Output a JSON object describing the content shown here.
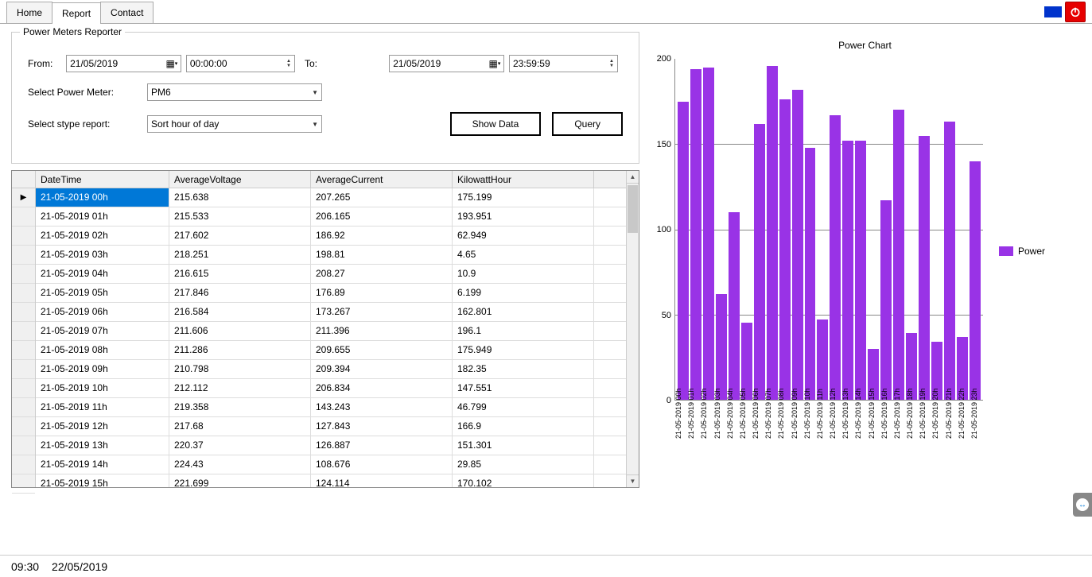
{
  "tabs": {
    "home": "Home",
    "report": "Report",
    "contact": "Contact",
    "active": "report"
  },
  "reporter": {
    "title": "Power Meters Reporter",
    "from_label": "From:",
    "from_date": "21/05/2019",
    "from_time": "00:00:00",
    "to_label": "To:",
    "to_date": "21/05/2019",
    "to_time": "23:59:59",
    "meter_label": "Select Power Meter:",
    "meter_value": "PM6",
    "stype_label": "Select stype report:",
    "stype_value": "Sort hour of day",
    "show_data": "Show Data",
    "query": "Query"
  },
  "grid": {
    "cols": {
      "dt": "DateTime",
      "av": "AverageVoltage",
      "ac": "AverageCurrent",
      "kh": "KilowattHour"
    },
    "rows": [
      {
        "dt": "21-05-2019 00h",
        "av": "215.638",
        "ac": "207.265",
        "kh": "175.199"
      },
      {
        "dt": "21-05-2019 01h",
        "av": "215.533",
        "ac": "206.165",
        "kh": "193.951"
      },
      {
        "dt": "21-05-2019 02h",
        "av": "217.602",
        "ac": "186.92",
        "kh": "62.949"
      },
      {
        "dt": "21-05-2019 03h",
        "av": "218.251",
        "ac": "198.81",
        "kh": "4.65"
      },
      {
        "dt": "21-05-2019 04h",
        "av": "216.615",
        "ac": "208.27",
        "kh": "10.9"
      },
      {
        "dt": "21-05-2019 05h",
        "av": "217.846",
        "ac": "176.89",
        "kh": "6.199"
      },
      {
        "dt": "21-05-2019 06h",
        "av": "216.584",
        "ac": "173.267",
        "kh": "162.801"
      },
      {
        "dt": "21-05-2019 07h",
        "av": "211.606",
        "ac": "211.396",
        "kh": "196.1"
      },
      {
        "dt": "21-05-2019 08h",
        "av": "211.286",
        "ac": "209.655",
        "kh": "175.949"
      },
      {
        "dt": "21-05-2019 09h",
        "av": "210.798",
        "ac": "209.394",
        "kh": "182.35"
      },
      {
        "dt": "21-05-2019 10h",
        "av": "212.112",
        "ac": "206.834",
        "kh": "147.551"
      },
      {
        "dt": "21-05-2019 11h",
        "av": "219.358",
        "ac": "143.243",
        "kh": "46.799"
      },
      {
        "dt": "21-05-2019 12h",
        "av": "217.68",
        "ac": "127.843",
        "kh": "166.9"
      },
      {
        "dt": "21-05-2019 13h",
        "av": "220.37",
        "ac": "126.887",
        "kh": "151.301"
      },
      {
        "dt": "21-05-2019 14h",
        "av": "224.43",
        "ac": "108.676",
        "kh": "29.85"
      },
      {
        "dt": "21-05-2019 15h",
        "av": "221.699",
        "ac": "124.114",
        "kh": "170.102"
      }
    ]
  },
  "chart": {
    "title": "Power Chart",
    "legend": "Power"
  },
  "chart_data": {
    "type": "bar",
    "title": "Power Chart",
    "ylabel": "",
    "xlabel": "",
    "ylim": [
      0,
      200
    ],
    "yticks": [
      0,
      50,
      100,
      150,
      200
    ],
    "categories": [
      "21-05-2019 00h",
      "21-05-2019 01h",
      "21-05-2019 02h",
      "21-05-2019 03h",
      "21-05-2019 04h",
      "21-05-2019 05h",
      "21-05-2019 06h",
      "21-05-2019 07h",
      "21-05-2019 08h",
      "21-05-2019 09h",
      "21-05-2019 10h",
      "21-05-2019 11h",
      "21-05-2019 12h",
      "21-05-2019 13h",
      "21-05-2019 14h",
      "21-05-2019 15h",
      "21-05-2019 16h",
      "21-05-2019 17h",
      "21-05-2019 18h",
      "21-05-2019 19h",
      "21-05-2019 20h",
      "21-05-2019 21h",
      "21-05-2019 22h",
      "21-05-2019 23h"
    ],
    "series": [
      {
        "name": "Power",
        "values": [
          175,
          194,
          195,
          62,
          110,
          45,
          162,
          196,
          176,
          182,
          148,
          47,
          167,
          152,
          152,
          30,
          117,
          170,
          39,
          155,
          34,
          163,
          37,
          140
        ]
      }
    ],
    "color": "#9933e6"
  },
  "status": {
    "time": "09:30",
    "date": "22/05/2019"
  }
}
